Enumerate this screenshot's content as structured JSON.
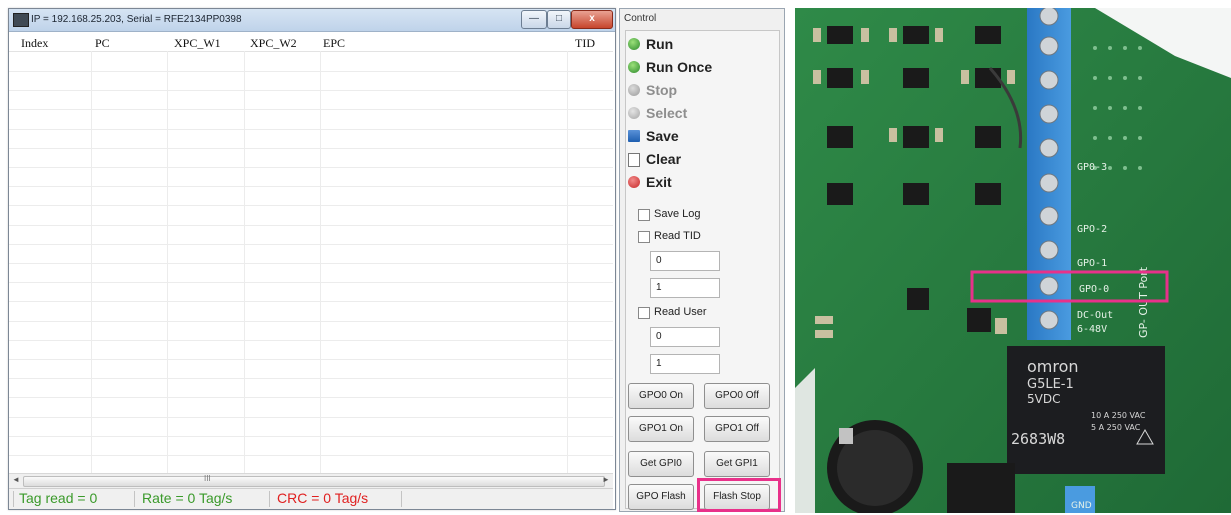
{
  "window": {
    "title": "IP = 192.168.25.203, Serial = RFE2134PP0398",
    "caption_min": "—",
    "caption_max": "□",
    "caption_close": "x"
  },
  "grid": {
    "columns": [
      "Index",
      "PC",
      "XPC_W1",
      "XPC_W2",
      "EPC",
      "TID"
    ]
  },
  "scrollbar": {
    "left_arrow": "◄",
    "right_arrow": "►",
    "grip": "III"
  },
  "status": {
    "tag_read": "Tag read = 0",
    "rate": "Rate = 0 Tag/s",
    "crc": "CRC = 0 Tag/s"
  },
  "control": {
    "title": "Control",
    "menu": [
      {
        "label": "Run",
        "icon": "green-play-icon",
        "color": "#2c8a2c",
        "enabled": true
      },
      {
        "label": "Run Once",
        "icon": "green-play-icon",
        "color": "#2c8a2c",
        "enabled": true
      },
      {
        "label": "Stop",
        "icon": "stop-icon",
        "color": "#9a9a9a",
        "enabled": false
      },
      {
        "label": "Select",
        "icon": "select-icon",
        "color": "#9a9a9a",
        "enabled": false
      },
      {
        "label": "Save",
        "icon": "floppy-icon",
        "color": "#1f5fb0",
        "enabled": true
      },
      {
        "label": "Clear",
        "icon": "document-icon",
        "color": "#cfcfcf",
        "enabled": true
      },
      {
        "label": "Exit",
        "icon": "red-x-icon",
        "color": "#c62828",
        "enabled": true
      }
    ],
    "save_log": "Save Log",
    "read_tid": "Read TID",
    "tid_field_1": "0",
    "tid_field_2": "1",
    "read_user": "Read User",
    "user_field_1": "0",
    "user_field_2": "1",
    "buttons": {
      "gpo0_on": "GPO0 On",
      "gpo0_off": "GPO0 Off",
      "gpo1_on": "GPO1 On",
      "gpo1_off": "GPO1 Off",
      "get_gpi0": "Get GPI0",
      "get_gpi1": "Get GPI1",
      "gpo_flash": "GPO Flash",
      "flash_stop": "Flash Stop"
    },
    "highlight_color": "#e8318a"
  },
  "photo": {
    "terminal_labels": [
      "GP0-3",
      "GPO-2",
      "GPO-1",
      "GPO-0"
    ],
    "dc_label_1": "DC-Out",
    "dc_label_2": "6-48V",
    "side_label": "GP- OUT Port",
    "relay_brand": "omron",
    "relay_model": "G5LE-1",
    "relay_voltage": "5VDC",
    "relay_rating_1": "10 A 250 VAC",
    "relay_rating_2": "5 A 250 VAC",
    "relay_code": "2683W8",
    "gnd_label": "GND",
    "highlight_color": "#e8318a"
  }
}
